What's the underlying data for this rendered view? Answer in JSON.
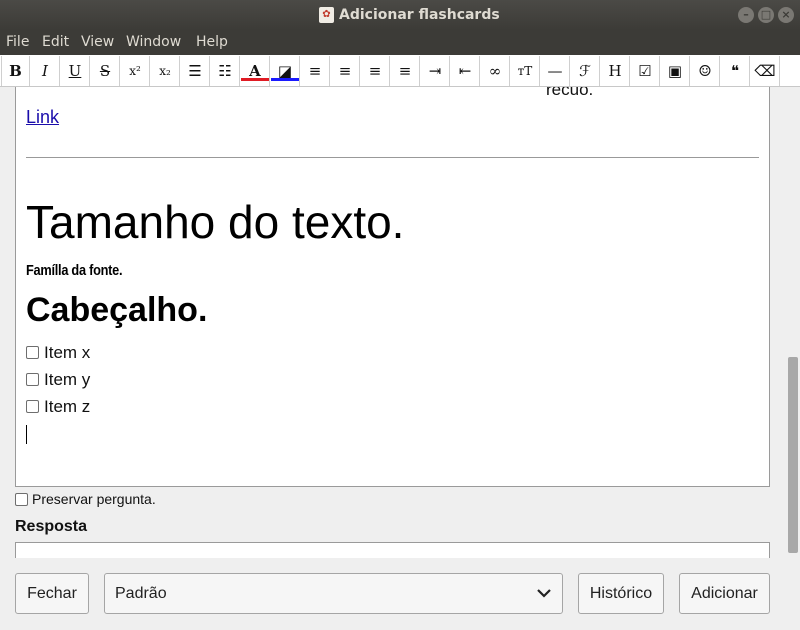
{
  "window": {
    "title": "Adicionar flashcards"
  },
  "menu": [
    "File",
    "Edit",
    "View",
    "Window",
    "Help"
  ],
  "toolbar": [
    {
      "name": "bold",
      "glyph": "B"
    },
    {
      "name": "italic",
      "glyph": "I"
    },
    {
      "name": "underline",
      "glyph": "U"
    },
    {
      "name": "strikethrough",
      "glyph": "S"
    },
    {
      "name": "superscript",
      "glyph": "x²"
    },
    {
      "name": "subscript",
      "glyph": "x₂"
    },
    {
      "name": "bullet-list",
      "glyph": "☰"
    },
    {
      "name": "numbered-list",
      "glyph": "☷"
    },
    {
      "name": "text-color",
      "glyph": "A"
    },
    {
      "name": "highlight",
      "glyph": "◪"
    },
    {
      "name": "align-left",
      "glyph": "≡"
    },
    {
      "name": "align-center",
      "glyph": "≡"
    },
    {
      "name": "align-right",
      "glyph": "≡"
    },
    {
      "name": "justify",
      "glyph": "≡"
    },
    {
      "name": "indent",
      "glyph": "⇥"
    },
    {
      "name": "outdent",
      "glyph": "⇤"
    },
    {
      "name": "link",
      "glyph": "∞"
    },
    {
      "name": "text-size",
      "glyph": "ᴛT"
    },
    {
      "name": "horizontal-rule",
      "glyph": "—"
    },
    {
      "name": "font-family",
      "glyph": "ℱ"
    },
    {
      "name": "heading",
      "glyph": "H"
    },
    {
      "name": "checkbox",
      "glyph": "☑"
    },
    {
      "name": "image",
      "glyph": "▣"
    },
    {
      "name": "emoji",
      "glyph": "☺"
    },
    {
      "name": "blockquote",
      "glyph": "❝"
    },
    {
      "name": "clear-format",
      "glyph": "⌫"
    }
  ],
  "editor": {
    "partial_text": "recuo.",
    "link_text": "Link",
    "large_text": "Tamanho do texto.",
    "font_family_text": "Famílla da fonte.",
    "heading_text": "Cabeçalho.",
    "items": [
      "Item x",
      "Item y",
      "Item z"
    ]
  },
  "preserve_label": "Preservar pergunta.",
  "resposta_label": "Resposta",
  "buttons": {
    "close": "Fechar",
    "deck": "Padrão",
    "history": "Histórico",
    "add": "Adicionar"
  },
  "colors": {
    "text_color_bar": "#e01b24",
    "highlight_bar": "#1a1aff",
    "titlebar": "#3c3b37"
  }
}
